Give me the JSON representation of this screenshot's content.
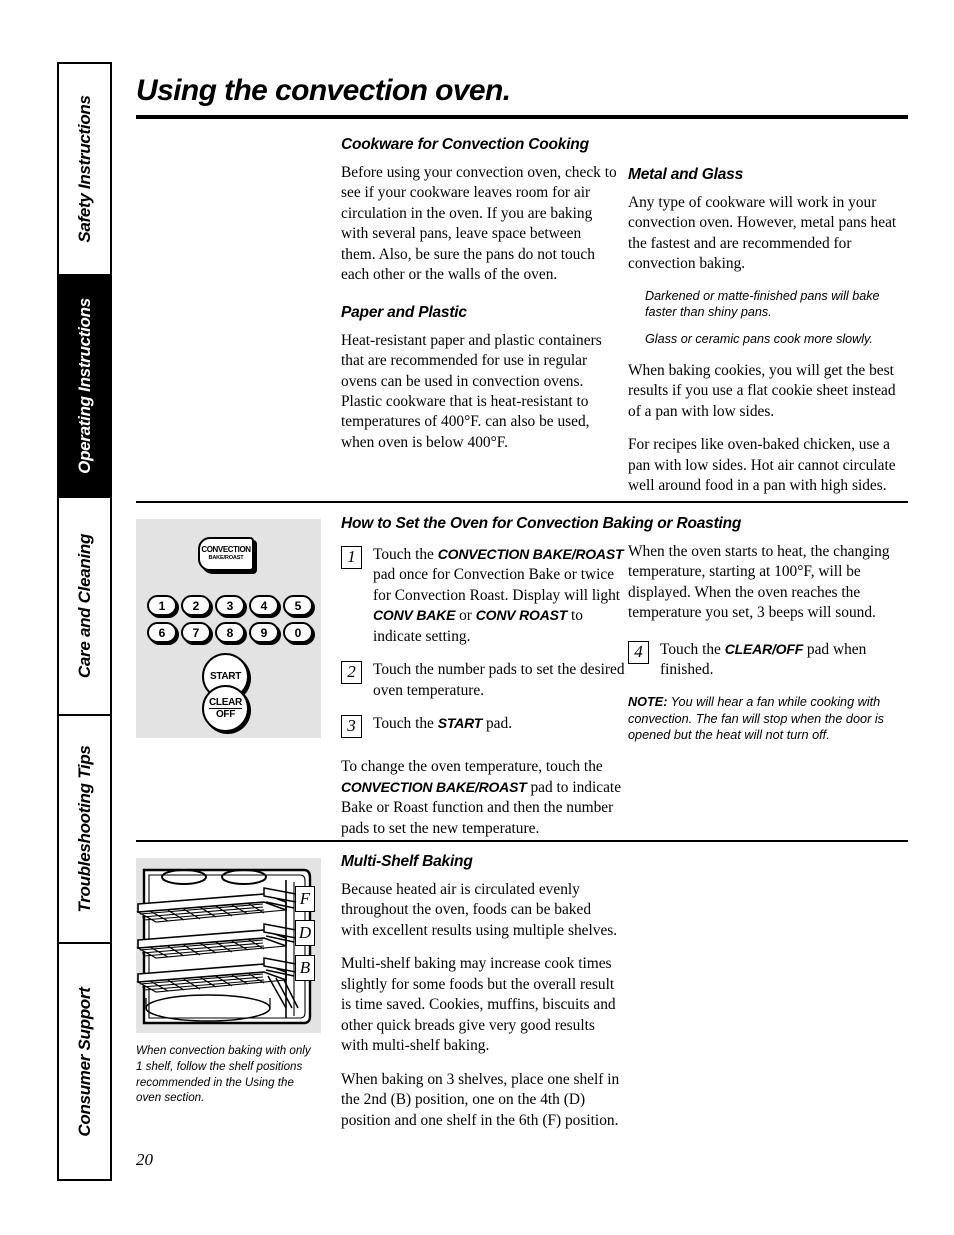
{
  "page": {
    "title": "Using the convection oven.",
    "number": "20"
  },
  "sidebar": {
    "tabs": [
      {
        "label": "Safety Instructions",
        "active": false
      },
      {
        "label": "Operating Instructions",
        "active": true
      },
      {
        "label": "Care and Cleaning",
        "active": false
      },
      {
        "label": "Troubleshooting Tips",
        "active": false
      },
      {
        "label": "Consumer Support",
        "active": false
      }
    ]
  },
  "section_cookware": {
    "heading": "Cookware for Convection Cooking",
    "para1": "Before using your convection oven, check to see if your cookware leaves room for air circulation in the oven. If you are baking with several pans, leave space between them. Also, be sure the pans do not touch each other or the walls of the oven."
  },
  "section_paper": {
    "heading": "Paper and Plastic",
    "para1": "Heat-resistant paper and plastic containers that are recommended for use in regular ovens can be used in convection ovens. Plastic cookware that is heat-resistant to temperatures of 400°F. can also be used, when oven is below 400°F."
  },
  "section_metal": {
    "heading": "Metal and Glass",
    "para1": "Any type of cookware will work in your convection oven. However, metal pans heat the fastest and are recommended for convection baking.",
    "note1": "Darkened or matte-finished pans will bake faster than shiny pans.",
    "note2": "Glass or ceramic pans cook more slowly.",
    "para2": "When baking cookies, you will get the best results if you use a flat cookie sheet instead of a pan with low sides.",
    "para3": "For recipes like oven-baked chicken, use a pan with low sides. Hot air cannot circulate well around food in a pan with high sides."
  },
  "section_howto": {
    "heading": "How to Set the Oven for Convection Baking or Roasting",
    "step1": {
      "num": "1",
      "t1": "Touch the ",
      "pad1": "CONVECTION BAKE/ROAST",
      "t2": " pad once for Convection Bake or twice for Convection Roast. Display will light ",
      "pad2": "CONV BAKE",
      "t3": " or ",
      "pad3": "CONV ROAST",
      "t4": " to indicate setting."
    },
    "step2": {
      "num": "2",
      "text": "Touch the number pads to set the desired oven temperature."
    },
    "step3": {
      "num": "3",
      "t1": "Touch the ",
      "pad1": "START",
      "t2": " pad."
    },
    "step4": {
      "num": "4",
      "t1": "Touch the ",
      "pad1": "CLEAR/OFF",
      "t2": " pad when finished."
    },
    "after_steps": {
      "t1": "To change the oven temperature, touch the ",
      "pad1": "CONVECTION BAKE/ROAST",
      "t2": " pad to indicate Bake or Roast function and then the number pads to set the new temperature."
    },
    "right_para": "When the oven starts to heat, the changing temperature, starting at 100°F, will be displayed. When the oven reaches the temperature you set, 3 beeps will sound.",
    "note_label": "NOTE:",
    "note_text": " You will hear a fan while cooking with convection. The fan will stop when the door is opened but the heat will not turn off."
  },
  "control_panel": {
    "convection_pad_line1": "CONVECTION",
    "convection_pad_line2": "BAKE/ROAST",
    "numbers_row1": [
      "1",
      "2",
      "3",
      "4",
      "5"
    ],
    "numbers_row2": [
      "6",
      "7",
      "8",
      "9",
      "0"
    ],
    "start_pad": "START",
    "clear_pad_line1": "CLEAR",
    "clear_pad_line2": "OFF"
  },
  "oven_illustration": {
    "shelf_labels": [
      "F",
      "D",
      "B"
    ],
    "caption": "When convection baking with only 1 shelf, follow the shelf positions recommended in the Using the oven section."
  },
  "section_multishelf": {
    "heading": "Multi-Shelf Baking",
    "para1": "Because heated air is circulated evenly throughout the oven, foods can be baked with excellent results using multiple shelves.",
    "para2": "Multi-shelf baking may increase cook times slightly for some foods but the overall result is time saved. Cookies, muffins, biscuits and other quick breads give very good results with multi-shelf baking.",
    "para3": "When baking on 3 shelves, place one shelf in the 2nd (B) position, one on the 4th (D) position and one shelf in the 6th (F) position."
  }
}
